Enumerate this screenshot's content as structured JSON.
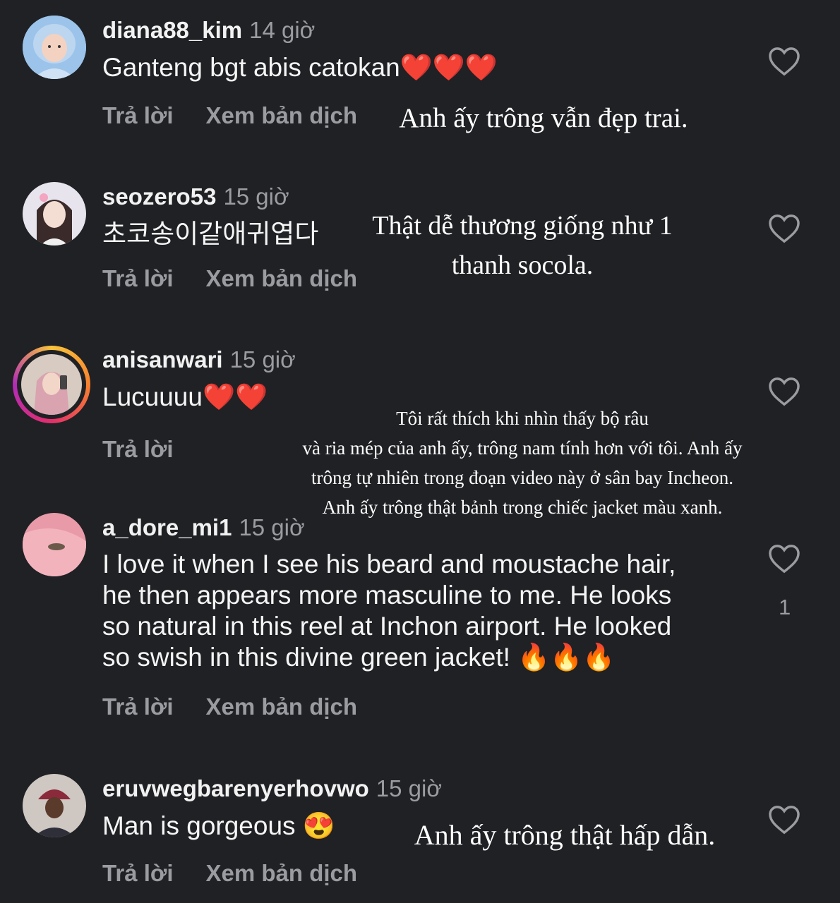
{
  "comments": [
    {
      "username": "diana88_kim",
      "time": "14 giờ",
      "text": "Ganteng bgt abis catokan❤️❤️❤️",
      "reply": "Trả lời",
      "translate": "Xem bản dịch",
      "overlay": "Anh ấy trông vẫn đẹp trai."
    },
    {
      "username": "seozero53",
      "time": "15 giờ",
      "text": "초코송이같애귀엽다",
      "reply": "Trả lời",
      "translate": "Xem bản dịch",
      "overlay_line1": "Thật dễ thương giống như 1",
      "overlay_line2": "thanh socola."
    },
    {
      "username": "anisanwari",
      "time": "15 giờ",
      "text": "Lucuuuu❤️❤️",
      "reply": "Trả lời",
      "overlay_line1": "Tôi rất thích khi nhìn thấy bộ râu",
      "overlay_line2": "và ria mép của anh ấy, trông nam tính hơn với tôi. Anh ấy",
      "overlay_line3": "trông tự nhiên trong đoạn video này ở sân bay Incheon.",
      "overlay_line4": "Anh ấy trông thật bảnh trong chiếc jacket màu xanh."
    },
    {
      "username": "a_dore_mi1",
      "time": "15 giờ",
      "text_line1": "I love it when I see his beard and moustache hair,",
      "text_line2": "he then appears more masculine to me. He looks",
      "text_line3": "so natural in this reel at Inchon airport. He looked",
      "text_line4": "so swish in this divine green jacket! 🔥🔥🔥",
      "likes": "1",
      "reply": "Trả lời",
      "translate": "Xem bản dịch"
    },
    {
      "username": "eruvwegbarenyerhovwo",
      "time": "15 giờ",
      "text": "Man is gorgeous 😍",
      "reply": "Trả lời",
      "translate": "Xem bản dịch",
      "overlay": "Anh ấy trông thật hấp dẫn."
    }
  ],
  "icons": {
    "like": "heart-outline-icon"
  },
  "colors": {
    "background": "#1f2124",
    "secondary_text": "#9a9ca1",
    "story_ring": "#e32f6b"
  }
}
